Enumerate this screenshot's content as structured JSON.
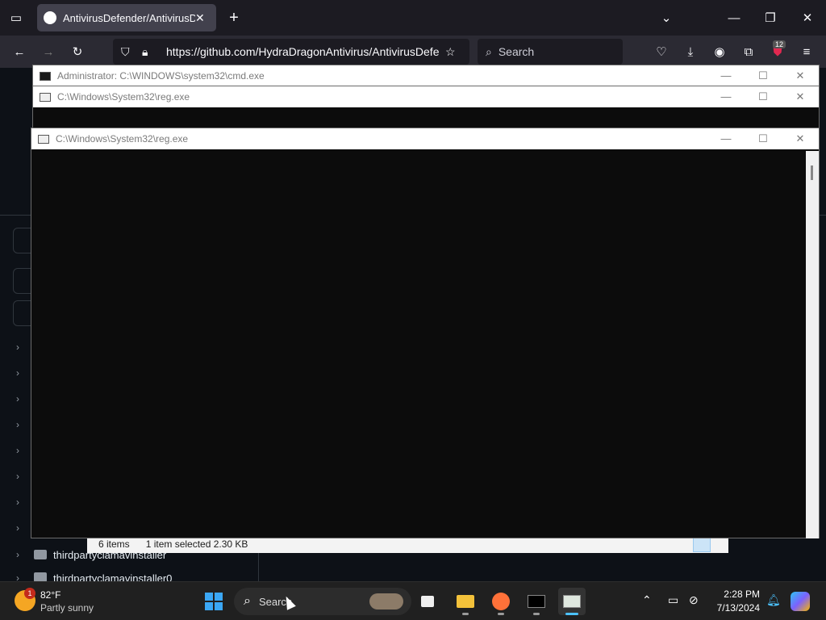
{
  "browser": {
    "tab_title": "AntivirusDefender/AntivirusDef",
    "url": "https://github.com/HydraDragonAntivirus/AntivirusDefe",
    "search_placeholder": "Search",
    "extensions_badge": "12"
  },
  "repo_tree": {
    "items": [
      {
        "label": ""
      },
      {
        "label": ""
      },
      {
        "label": ""
      },
      {
        "label": ""
      },
      {
        "label": ""
      },
      {
        "label": ""
      },
      {
        "label": ""
      },
      {
        "label": ""
      },
      {
        "label": "thirdpartyclamavinstaller"
      },
      {
        "label": "thirdpartyclamavinstaller0"
      }
    ]
  },
  "explorer": {
    "items_count": "6 items",
    "selection": "1 item selected  2.30 KB"
  },
  "windows": {
    "cmd_title": "Administrator: C:\\WINDOWS\\system32\\cmd.exe",
    "reg1_title": "C:\\Windows\\System32\\reg.exe",
    "reg2_title": "C:\\Windows\\System32\\reg.exe"
  },
  "taskbar": {
    "weather_temp": "82°F",
    "weather_desc": "Partly sunny",
    "weather_badge": "1",
    "search_label": "Search",
    "time": "2:28 PM",
    "date": "7/13/2024"
  }
}
